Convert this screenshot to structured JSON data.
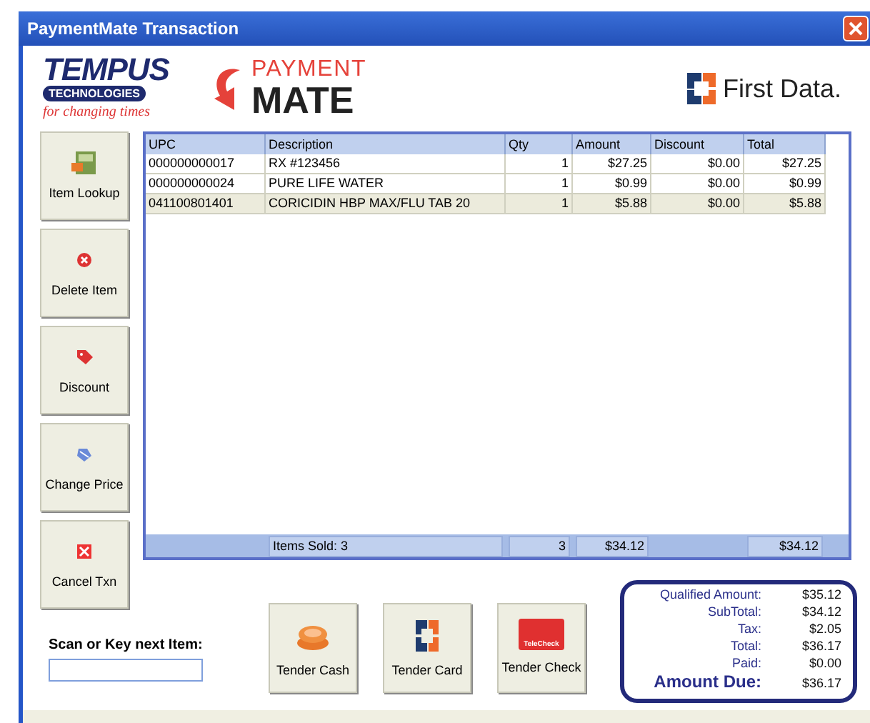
{
  "window": {
    "title": "PaymentMate Transaction"
  },
  "logos": {
    "tempus": {
      "name": "TEMPUS",
      "sub": "TECHNOLOGIES",
      "tagline": "for changing times"
    },
    "paymentmate": {
      "top": "PAYMENT",
      "bottom": "MATE"
    },
    "firstdata": {
      "name": "First Data",
      "mark": "."
    }
  },
  "side_buttons": [
    {
      "label": "Item Lookup",
      "kind": "lookup"
    },
    {
      "label": "Delete Item",
      "kind": "delete"
    },
    {
      "label": "Discount",
      "kind": "discount"
    },
    {
      "label": "Change Price",
      "kind": "price"
    },
    {
      "label": "Cancel Txn",
      "kind": "cancel"
    }
  ],
  "table": {
    "columns": [
      "UPC",
      "Description",
      "Qty",
      "Amount",
      "Discount",
      "Total"
    ],
    "rows": [
      {
        "cells": [
          "000000000017",
          "RX #123456",
          "1",
          "$27.25",
          "$0.00",
          "$27.25"
        ],
        "selected": false
      },
      {
        "cells": [
          "000000000024",
          "PURE LIFE WATER",
          "1",
          "$0.99",
          "$0.00",
          "$0.99"
        ],
        "selected": false
      },
      {
        "cells": [
          "041100801401",
          "CORICIDIN HBP MAX/FLU TAB 20",
          "1",
          "$5.88",
          "$0.00",
          "$5.88"
        ],
        "selected": true
      }
    ],
    "footer": {
      "description": "Items Sold: 3",
      "qty": "3",
      "amount": "$34.12",
      "total": "$34.12"
    }
  },
  "scan": {
    "label": "Scan or Key next Item:"
  },
  "tender_buttons": [
    {
      "label": "Tender Cash",
      "kind": "cash"
    },
    {
      "label": "Tender Card",
      "kind": "card"
    },
    {
      "label": "Tender Check",
      "kind": "check",
      "icon_text": "TeleCheck"
    }
  ],
  "summary": [
    {
      "label": "Qualified Amount:",
      "value": "$35.12",
      "emphasis": false
    },
    {
      "label": "SubTotal:",
      "value": "$34.12",
      "emphasis": false
    },
    {
      "label": "Tax:",
      "value": "$2.05",
      "emphasis": false
    },
    {
      "label": "Total:",
      "value": "$36.17",
      "emphasis": false
    },
    {
      "label": "Paid:",
      "value": "$0.00",
      "emphasis": false
    },
    {
      "label": "Amount Due:",
      "value": "$36.17",
      "emphasis": true
    }
  ]
}
